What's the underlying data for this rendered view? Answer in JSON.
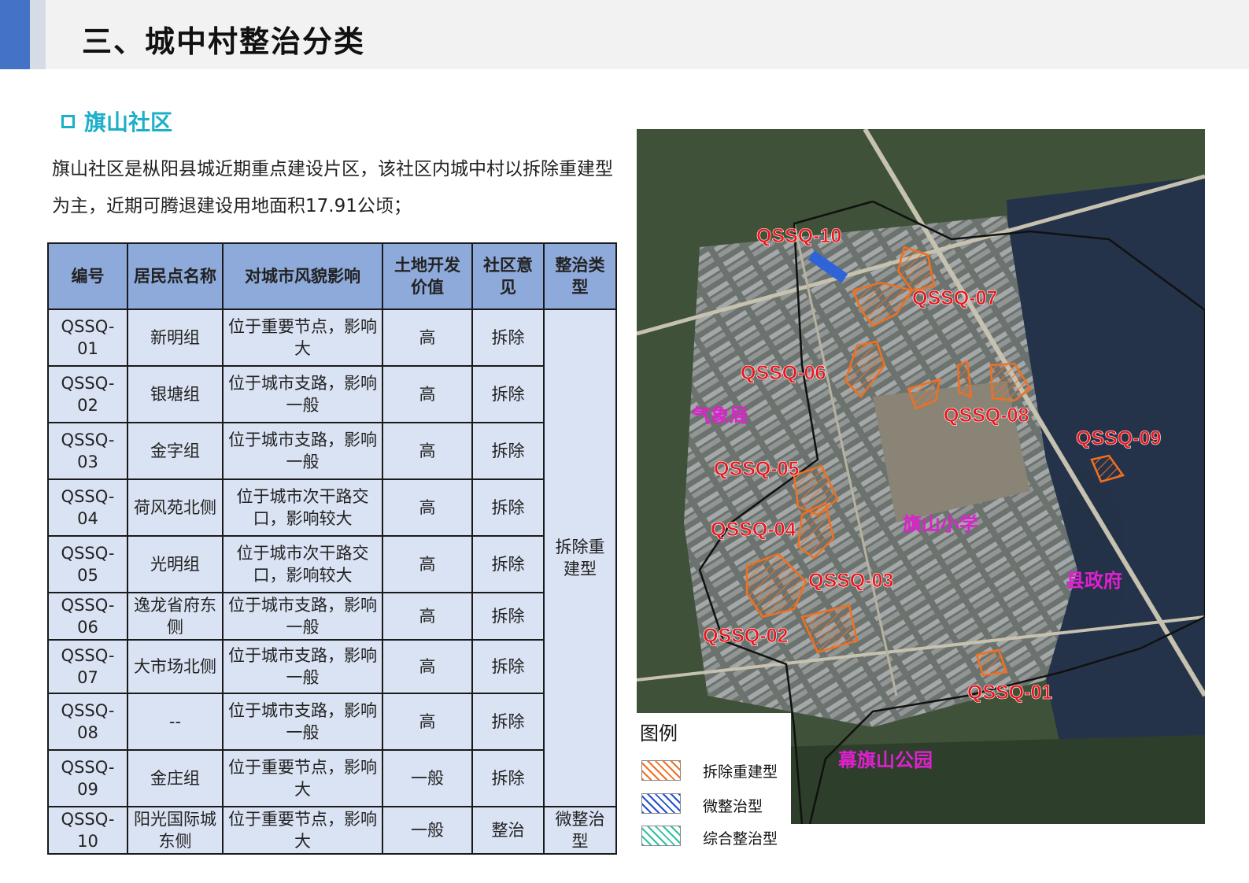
{
  "header": {
    "title": "三、城中村整治分类"
  },
  "section": {
    "title": "旗山社区"
  },
  "intro": {
    "text": "旗山社区是枞阳县城近期重点建设片区，该社区内城中村以拆除重建型为主，近期可腾退建设用地面积17.91公顷；"
  },
  "table": {
    "headers": [
      "编号",
      "居民点名称",
      "对城市风貌影响",
      "土地开发价值",
      "社区意见",
      "整治类型"
    ],
    "rows": [
      {
        "id": "QSSQ-01",
        "name": "新明组",
        "impact": "位于重要节点，影响大",
        "value": "高",
        "opinion": "拆除"
      },
      {
        "id": "QSSQ-02",
        "name": "银塘组",
        "impact": "位于城市支路，影响一般",
        "value": "高",
        "opinion": "拆除"
      },
      {
        "id": "QSSQ-03",
        "name": "金字组",
        "impact": "位于城市支路，影响一般",
        "value": "高",
        "opinion": "拆除"
      },
      {
        "id": "QSSQ-04",
        "name": "荷风苑北侧",
        "impact": "位于城市次干路交口，影响较大",
        "value": "高",
        "opinion": "拆除"
      },
      {
        "id": "QSSQ-05",
        "name": "光明组",
        "impact": "位于城市次干路交口，影响较大",
        "value": "高",
        "opinion": "拆除"
      },
      {
        "id": "QSSQ-06",
        "name": "逸龙省府东侧",
        "impact": "位于城市支路，影响一般",
        "value": "高",
        "opinion": "拆除"
      },
      {
        "id": "QSSQ-07",
        "name": "大市场北侧",
        "impact": "位于城市支路，影响一般",
        "value": "高",
        "opinion": "拆除"
      },
      {
        "id": "QSSQ-08",
        "name": "--",
        "impact": "位于城市支路，影响一般",
        "value": "高",
        "opinion": "拆除"
      },
      {
        "id": "QSSQ-09",
        "name": "金庄组",
        "impact": "位于重要节点，影响大",
        "value": "一般",
        "opinion": "拆除"
      },
      {
        "id": "QSSQ-10",
        "name": "阳光国际城东侧",
        "impact": "位于重要节点，影响大",
        "value": "一般",
        "opinion": "整治"
      }
    ],
    "type_group1": "拆除重建型",
    "type_group2": "微整治型"
  },
  "map": {
    "zone_labels": [
      "QSSQ-10",
      "QSSQ-07",
      "QSSQ-06",
      "QSSQ-08",
      "QSSQ-09",
      "QSSQ-05",
      "QSSQ-04",
      "QSSQ-03",
      "QSSQ-02",
      "QSSQ-01"
    ],
    "place_labels": [
      "气象局",
      "旗山小学",
      "县政府",
      "幕旗山公园"
    ],
    "zone_label_color": "#e8161b",
    "place_label_color": "#e020d0",
    "zone_outline_color": "#f07020"
  },
  "legend": {
    "title": "图例",
    "items": [
      {
        "label": "拆除重建型",
        "color": "#f07020"
      },
      {
        "label": "微整治型",
        "color": "#2050d0"
      },
      {
        "label": "综合整治型",
        "color": "#30c0a0"
      }
    ]
  }
}
